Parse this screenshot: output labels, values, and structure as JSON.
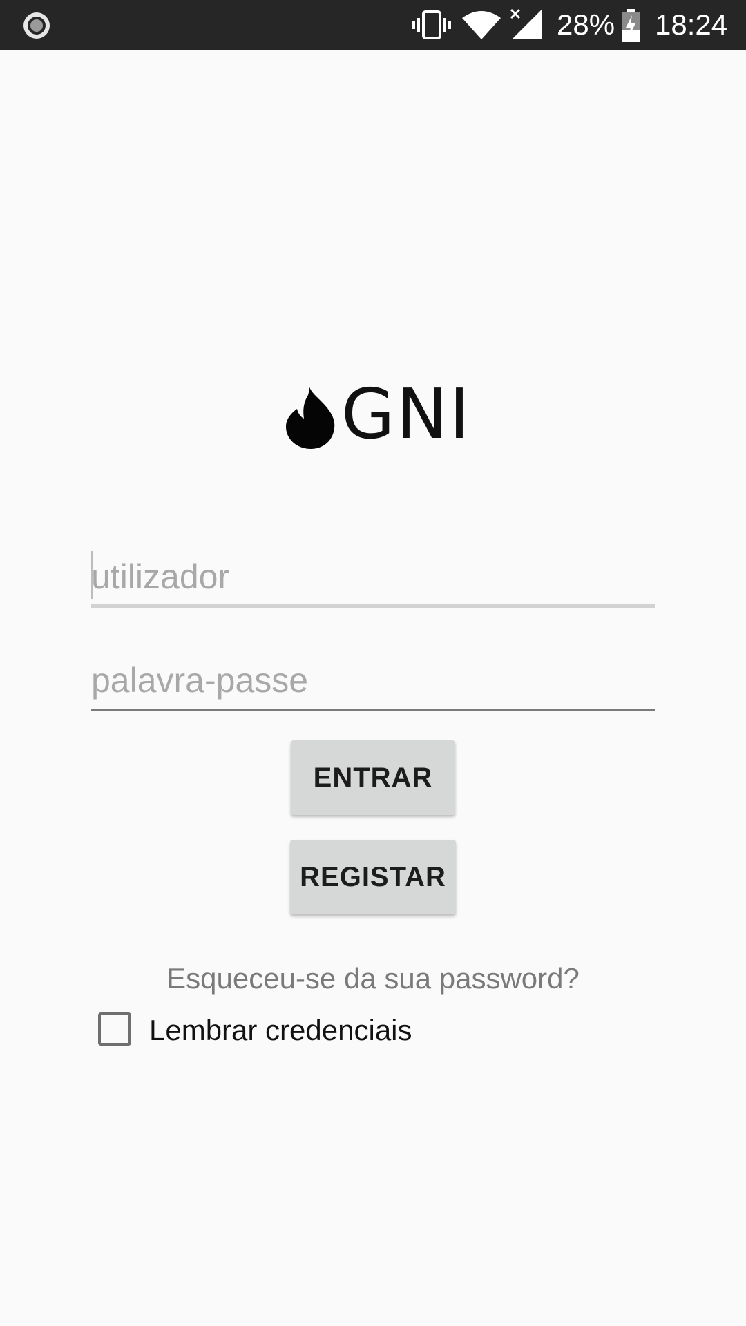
{
  "status_bar": {
    "battery_percent": "28%",
    "time": "18:24",
    "icons": [
      "screen-record-icon",
      "vibrate-icon",
      "wifi-icon",
      "signal-icon",
      "battery-charging-icon"
    ]
  },
  "logo": {
    "icon": "flame-icon",
    "text": "GNI"
  },
  "login_form": {
    "username_placeholder": "utilizador",
    "password_placeholder": "palavra-passe",
    "login_button_label": "ENTRAR",
    "register_button_label": "REGISTAR",
    "forgot_password_text": "Esqueceu-se da sua password?",
    "remember_label": "Lembrar credenciais",
    "remember_checked": false
  },
  "colors": {
    "status_bar_bg": "#262626",
    "background": "#fafafa",
    "button_bg": "#d6d7d7",
    "hint_text": "#a8a8a8"
  }
}
